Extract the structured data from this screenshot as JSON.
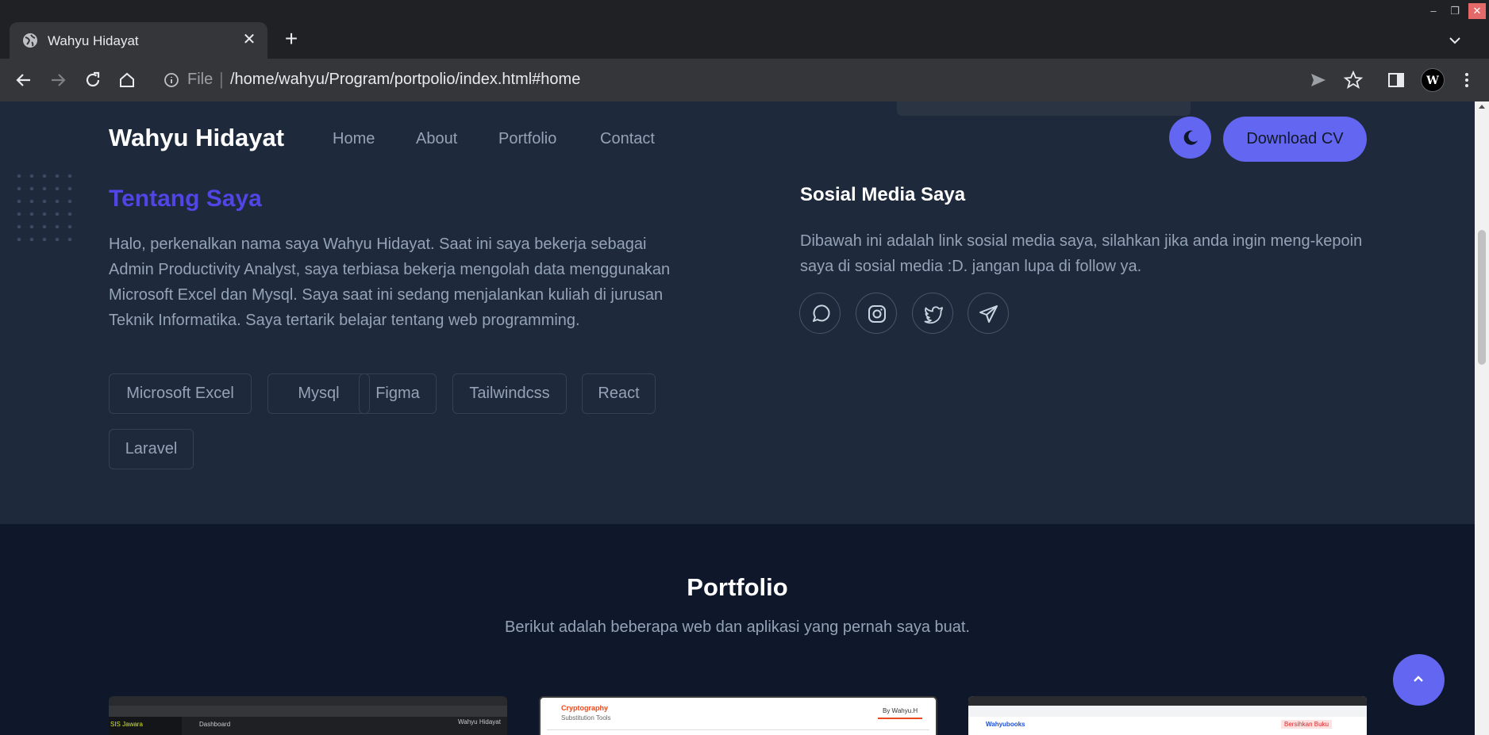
{
  "browser": {
    "tab_title": "Wahyu Hidayat",
    "file_label": "File",
    "url": "/home/wahyu/Program/portpolio/index.html#home"
  },
  "nav": {
    "brand": "Wahyu Hidayat",
    "links": [
      "Home",
      "About",
      "Portfolio",
      "Contact"
    ],
    "download_cv": "Download CV"
  },
  "about": {
    "title": "Tentang Saya",
    "text": "Halo, perkenalkan nama saya Wahyu Hidayat. Saat ini saya bekerja sebagai Admin Productivity Analyst, saya terbiasa bekerja mengolah data menggunakan Microsoft Excel dan Mysql. Saya saat ini sedang menjalankan kuliah di jurusan Teknik Informatika. Saya tertarik belajar tentang web programming.",
    "skills": [
      "Microsoft Excel",
      "Mysql",
      "Figma",
      "Tailwindcss",
      "React",
      "Laravel"
    ]
  },
  "social": {
    "title": "Sosial Media Saya",
    "text": "Dibawah ini adalah link sosial media saya, silahkan jika anda ingin meng-kepoin saya di sosial media :D. jangan lupa di follow ya.",
    "icons": [
      "whatsapp-icon",
      "instagram-icon",
      "twitter-icon",
      "telegram-icon"
    ]
  },
  "portfolio": {
    "title": "Portfolio",
    "subtitle": "Berikut adalah beberapa web dan aplikasi yang pernah saya buat.",
    "cards": [
      {
        "mini_title": "Dashboard",
        "mini_brand": "SIS Jawara",
        "mini_user": "Wahyu Hidayat"
      },
      {
        "mini_title": "Cryptography",
        "mini_sub": "Substitution Tools",
        "mini_badge": "By Wahyu.H"
      },
      {
        "mini_title": "Wahyubooks",
        "mini_btn": "Bersihkan Buku"
      }
    ]
  },
  "colors": {
    "accent": "#6366f1",
    "about_bg": "#1e293b",
    "portfolio_bg": "#0f172a",
    "title_accent": "#4f46e5"
  }
}
